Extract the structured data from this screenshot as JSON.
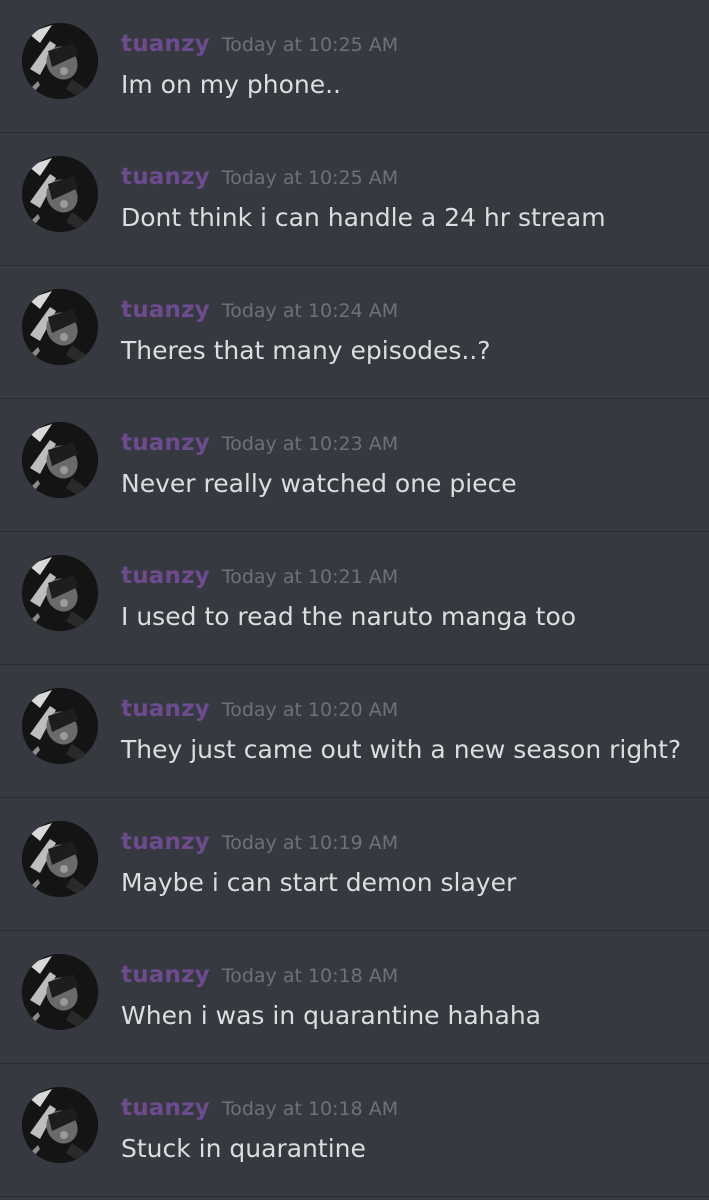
{
  "messages": [
    {
      "username": "tuanzy",
      "timestamp": "Today at 10:25 AM",
      "text": "Im on my phone.."
    },
    {
      "username": "tuanzy",
      "timestamp": "Today at 10:25 AM",
      "text": "Dont think i can handle a 24 hr stream"
    },
    {
      "username": "tuanzy",
      "timestamp": "Today at 10:24 AM",
      "text": "Theres that many episodes..?"
    },
    {
      "username": "tuanzy",
      "timestamp": "Today at 10:23 AM",
      "text": "Never really watched one piece"
    },
    {
      "username": "tuanzy",
      "timestamp": "Today at 10:21 AM",
      "text": "I used to read the naruto manga too"
    },
    {
      "username": "tuanzy",
      "timestamp": "Today at 10:20 AM",
      "text": "They just came out with a new season right?"
    },
    {
      "username": "tuanzy",
      "timestamp": "Today at 10:19 AM",
      "text": "Maybe i can start demon slayer"
    },
    {
      "username": "tuanzy",
      "timestamp": "Today at 10:18 AM",
      "text": "When i was in quarantine hahaha"
    },
    {
      "username": "tuanzy",
      "timestamp": "Today at 10:18 AM",
      "text": "Stuck in quarantine"
    }
  ],
  "colors": {
    "background": "#36393f",
    "username": "#6d4b8f",
    "timestamp": "#6f7178",
    "message_text": "#dcddde"
  }
}
